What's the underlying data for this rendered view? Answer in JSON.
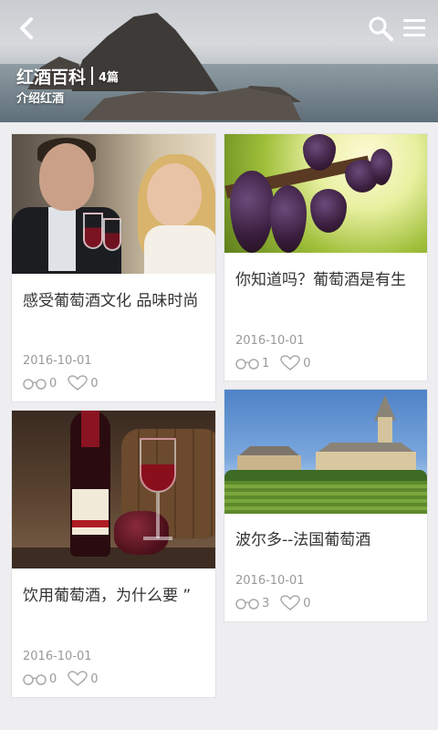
{
  "header": {
    "title": "红酒百科",
    "count": "4篇",
    "subtitle": "介绍红酒",
    "back_icon": "chevron-left-icon",
    "search_icon": "search-icon",
    "menu_icon": "menu-icon"
  },
  "articles": [
    {
      "title": "感受葡萄酒文化 品味时尚",
      "date": "2016-10-01",
      "views": "0",
      "likes": "0",
      "image": "couple-toasting-wine"
    },
    {
      "title": "你知道吗？葡萄酒是有生",
      "date": "2016-10-01",
      "views": "1",
      "likes": "0",
      "image": "grape-vine"
    },
    {
      "title": "饮用葡萄酒，为什么要 ”",
      "date": "2016-10-01",
      "views": "0",
      "likes": "0",
      "image": "wine-bottle-and-glass"
    },
    {
      "title": "波尔多--法国葡萄酒",
      "date": "2016-10-01",
      "views": "3",
      "likes": "0",
      "image": "bordeaux-village"
    }
  ]
}
